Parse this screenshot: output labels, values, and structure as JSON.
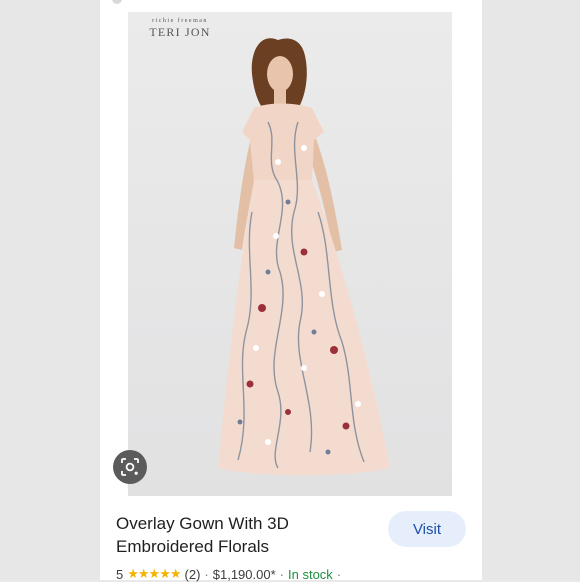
{
  "brand": {
    "top_line": "richie freeman",
    "name": "TERI JON"
  },
  "product": {
    "title_line1": "Overlay Gown With 3D",
    "title_line2": "Embroidered Florals",
    "rating": "5",
    "stars": "★★★★★",
    "review_count": "(2)",
    "price": "$1,190.00*",
    "stock": "In stock",
    "separator": "·"
  },
  "actions": {
    "visit_label": "Visit"
  },
  "icons": {
    "lens": "image-search-icon"
  },
  "colors": {
    "stars": "#f2b400",
    "stock": "#1e8e3e",
    "visit_bg": "#e6eefc",
    "visit_text": "#1a4fa8"
  }
}
